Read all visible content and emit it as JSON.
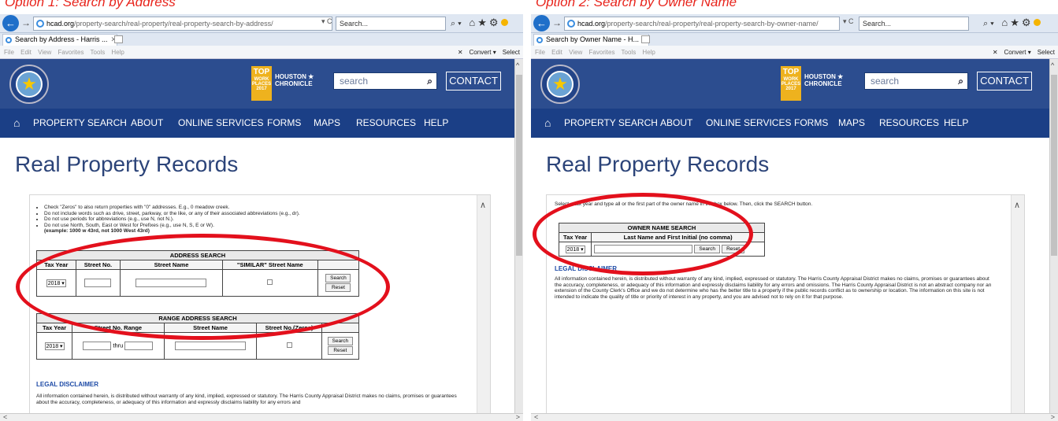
{
  "left": {
    "caption": "Option 1: Search by Address",
    "url_host": "hcad.org",
    "url_path": "/property-search/real-property/real-property-search-by-address/",
    "url_controls": "▾ C",
    "search_box": "Search...",
    "tab_title": "Search by Address - Harris ...",
    "menu": "File Edit View Favorites Tools Help",
    "menu_right": {
      "close": "✕",
      "convert": "Convert ▾",
      "select": "Select"
    },
    "site": {
      "top_badge": "TOP",
      "top_badge_sub": "WORK PLACES 2017",
      "chronicle": "HOUSTON ★ CHRONICLE",
      "search_placeholder": "search",
      "contact": "CONTACT",
      "nav": [
        "PROPERTY SEARCH",
        "ABOUT",
        "ONLINE SERVICES",
        "FORMS",
        "MAPS",
        "RESOURCES",
        "HELP"
      ],
      "title": "Real Property Records",
      "bullets": [
        "Check \"Zeros\" to also return properties with \"0\" addresses. E.g., 0 meadow creek.",
        "Do not include words such as drive, street, parkway, or the like, or any of their associated abbreviations (e.g., dr).",
        "Do not use periods for abbreviations (e.g., use N, not N.).",
        "Do not use North, South, East or West for Prefixes (e.g., use N, S, E or W)."
      ],
      "example": "(example: 1000 w 43rd, not 1000 West 43rd)",
      "address_search": {
        "caption": "ADDRESS SEARCH",
        "headers": [
          "Tax Year",
          "Street No.",
          "Street Name",
          "\"SIMILAR\" Street Name"
        ],
        "year": "2018",
        "search_btn": "Search",
        "reset_btn": "Reset"
      },
      "range_search": {
        "caption": "RANGE ADDRESS SEARCH",
        "headers": [
          "Tax Year",
          "Street No. Range",
          "Street Name",
          "Street No.(Zeros)"
        ],
        "year": "2018",
        "thru": "thru",
        "search_btn": "Search",
        "reset_btn": "Reset"
      },
      "legal_heading": "LEGAL DISCLAIMER",
      "legal_text": "All information contained herein, is distributed without warranty of any kind, implied, expressed or statutory. The Harris County Appraisal District makes no claims, promises or guarantees about the accuracy, completeness, or adequacy of this information and expressly disclaims liability for any errors and"
    }
  },
  "right": {
    "caption": "Option 2: Search by Owner Name",
    "url_host": "hcad.org",
    "url_path": "/property-search/real-property/real-property-search-by-owner-name/",
    "url_controls": "▾ C",
    "search_box": "Search...",
    "tab_title": "Search by Owner Name - H...",
    "menu": "File Edit View Favorites Tools Help",
    "menu_right": {
      "close": "✕",
      "convert": "Convert ▾",
      "select": "Select"
    },
    "site": {
      "top_badge": "TOP",
      "top_badge_sub": "WORK PLACES 2017",
      "chronicle": "HOUSTON ★ CHRONICLE",
      "search_placeholder": "search",
      "contact": "CONTACT",
      "nav": [
        "PROPERTY SEARCH",
        "ABOUT",
        "ONLINE SERVICES",
        "FORMS",
        "MAPS",
        "RESOURCES",
        "HELP"
      ],
      "title": "Real Property Records",
      "intro": "Select a tax year and type all or the first part of the owner name in the box below. Then, click the SEARCH button.",
      "owner_search": {
        "caption": "OWNER NAME SEARCH",
        "headers": [
          "Tax Year",
          "Last Name and First Initial (no comma)"
        ],
        "year": "2018",
        "search_btn": "Search",
        "reset_btn": "Reset"
      },
      "legal_heading": "LEGAL DISCLAIMER",
      "legal_text": "All information contained herein, is distributed without warranty of any kind, implied, expressed or statutory. The Harris County Appraisal District makes no claims, promises or guarantees about the accuracy, completeness, or adequacy of this information and expressly disclaims liability for any errors and omissions. The Harris County Appraisal District is not an abstract company nor an extension of the County Clerk's Office and we do not determine who has the better title to a property if the public records conflict as to ownership or location. The information on this site is not intended to indicate the quality of title or priority of interest in any property, and you are advised not to rely on it for that purpose."
    }
  },
  "icons": {
    "back": "back-arrow-icon",
    "forward": "forward-arrow-icon",
    "search": "magnifier-icon",
    "home": "home-icon",
    "star": "favorites-star-icon",
    "gear": "gear-icon",
    "smiley": "feedback-smiley-icon"
  },
  "colors": {
    "annotation": "#e3101c",
    "nav": "#1b3f86",
    "header": "#2c4d8f",
    "title": "#2c4479"
  }
}
